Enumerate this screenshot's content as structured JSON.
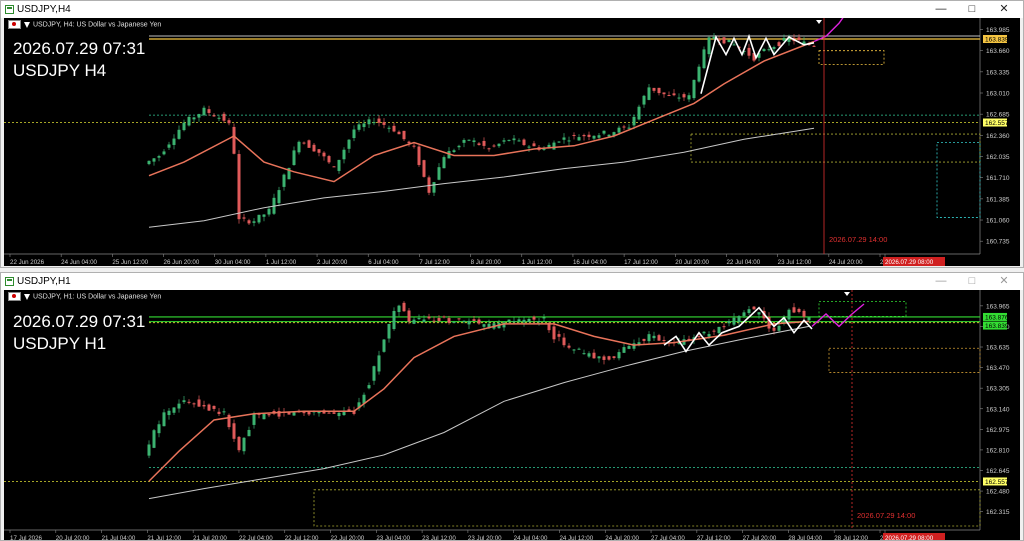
{
  "windows": [
    {
      "id": "h4",
      "title": "USDJPY,H4",
      "info_line": "USDJPY, H4:  US Dollar vs Japanese Yen",
      "overlay_time": "2026.07.29 07:31",
      "overlay_symbol": "USDJPY H4",
      "y_ticks": [
        "163.985",
        "163.660",
        "163.335",
        "163.010",
        "162.685",
        "162.360",
        "162.035",
        "161.710",
        "161.385",
        "161.060",
        "160.735"
      ],
      "y_range": [
        160.6,
        164.1
      ],
      "price_tags": [
        {
          "value": "163.839",
          "price": 163.839,
          "bg": "#f5c542",
          "fg": "#000000"
        },
        {
          "value": "162.557",
          "price": 162.557,
          "bg": "#ffff66",
          "fg": "#000000"
        }
      ],
      "x_labels": [
        "22 Jun 2026",
        "24 Jun 04:00",
        "25 Jun 12:00",
        "26 Jun 20:00",
        "30 Jun 04:00",
        "1 Jul 12:00",
        "2 Jul 20:00",
        "6 Jul 04:00",
        "7 Jul 12:00",
        "8 Jul 20:00",
        "1 Jul 12:00",
        "16 Jul 04:00",
        "17 Jul 12:00",
        "20 Jul 20:00",
        "22 Jul 04:00",
        "23 Jul 12:00",
        "24 Jul 20:00",
        "28 Jul 04:00",
        "2026.07.29 08:00"
      ],
      "vline_label": "2026.07.29 14:00",
      "colors": {
        "up": "#3cb371",
        "down": "#e05a5a",
        "ma_fast": "#e8735a",
        "ma_slow": "#c8c8c8",
        "vline": "#e03030"
      }
    },
    {
      "id": "h1",
      "title": "USDJPY,H1",
      "info_line": "USDJPY, H1:  US Dollar vs Japanese Yen",
      "overlay_time": "2026.07.29 07:31",
      "overlay_symbol": "USDJPY H1",
      "y_ticks": [
        "163.965",
        "163.800",
        "163.635",
        "163.470",
        "163.305",
        "163.140",
        "162.975",
        "162.810",
        "162.645",
        "162.480",
        "162.315"
      ],
      "y_range": [
        162.2,
        164.06
      ],
      "price_tags": [
        {
          "value": "163.876",
          "price": 163.876,
          "bg": "#33dd33",
          "fg": "#000000"
        },
        {
          "value": "163.839",
          "price": 163.839,
          "bg": "#33dd33",
          "fg": "#000000"
        },
        {
          "value": "162.557",
          "price": 162.557,
          "bg": "#ffff66",
          "fg": "#000000"
        }
      ],
      "x_labels": [
        "17 Jul 2026",
        "20 Jul 20:00",
        "21 Jul 04:00",
        "21 Jul 12:00",
        "21 Jul 20:00",
        "22 Jul 04:00",
        "22 Jul 12:00",
        "22 Jul 20:00",
        "23 Jul 04:00",
        "23 Jul 12:00",
        "23 Jul 20:00",
        "24 Jul 04:00",
        "24 Jul 12:00",
        "24 Jul 20:00",
        "27 Jul 04:00",
        "27 Jul 12:00",
        "27 Jul 20:00",
        "28 Jul 04:00",
        "28 Jul 12:00",
        "28 Jul 20:00",
        "2026.07.29 08:00"
      ],
      "vline_label": "2026.07.29 14:00",
      "colors": {
        "up": "#3cb371",
        "down": "#e05a5a",
        "ma_fast": "#e8735a",
        "ma_slow": "#c8c8c8",
        "vline": "#e03030"
      }
    }
  ],
  "icons": {
    "minimize": "minimize-icon",
    "maximize": "maximize-icon",
    "close": "close-icon",
    "window": "chart-window-icon"
  }
}
